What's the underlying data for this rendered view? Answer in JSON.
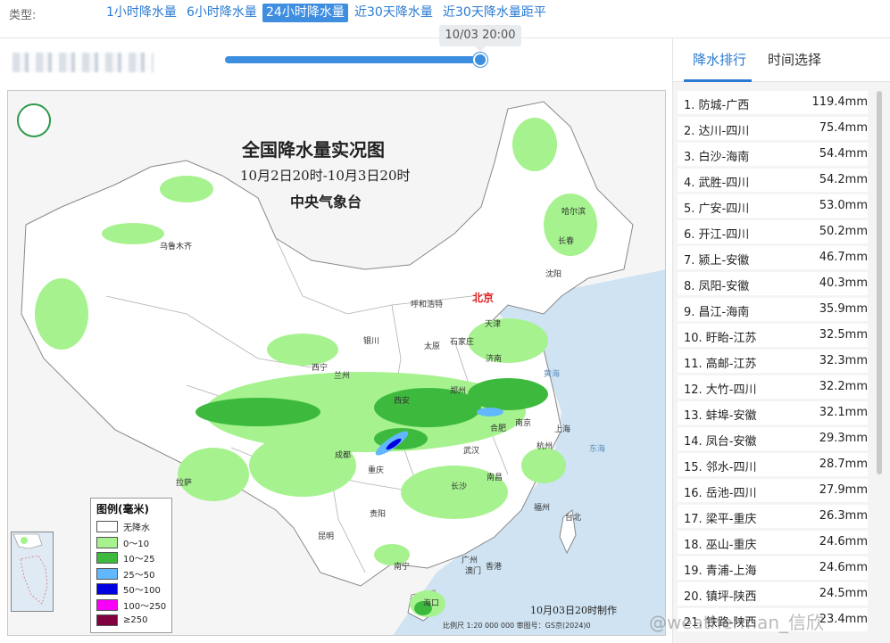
{
  "type_bar": {
    "label": "类型:",
    "tabs": [
      "1小时降水量",
      "6小时降水量",
      "24小时降水量",
      "近30天降水量",
      "近30天降水量距平"
    ],
    "active_index": 2
  },
  "slider": {
    "tooltip": "10/03 20:00",
    "position": 1.0
  },
  "map": {
    "title": "全国降水量实况图",
    "subtitle": "10月2日20时-10月3日20时",
    "agency": "中央气象台",
    "cities": [
      "乌鲁木齐",
      "哈尔滨",
      "长春",
      "沈阳",
      "北京",
      "天津",
      "呼和浩特",
      "银川",
      "太原",
      "石家庄",
      "济南",
      "西宁",
      "兰州",
      "郑州",
      "西安",
      "合肥",
      "南京",
      "上海",
      "杭州",
      "武汉",
      "成都",
      "重庆",
      "拉萨",
      "长沙",
      "南昌",
      "贵阳",
      "福州",
      "台北",
      "昆明",
      "南宁",
      "广州",
      "澳门",
      "香港",
      "海口"
    ],
    "seas": [
      "黄海",
      "东海"
    ],
    "legend": {
      "title": "图例(毫米)",
      "items": [
        {
          "label": "无降水",
          "color": "#ffffff"
        },
        {
          "label": "0～10",
          "color": "#a6f28f"
        },
        {
          "label": "10～25",
          "color": "#3dba3d"
        },
        {
          "label": "25～50",
          "color": "#61b8ff"
        },
        {
          "label": "50～100",
          "color": "#0000e1"
        },
        {
          "label": "100～250",
          "color": "#fa00fa"
        },
        {
          "label": "≥250",
          "color": "#800040"
        }
      ]
    },
    "made_note": "10月03日20时制作",
    "scale_note": "比例尺 1:20 000 000    审图号：GS京(2024)0"
  },
  "right_panel": {
    "tabs": [
      "降水排行",
      "时间选择"
    ],
    "active_index": 0,
    "ranking": [
      {
        "name": "1. 防城-广西",
        "value": "119.4mm"
      },
      {
        "name": "2. 达川-四川",
        "value": "75.4mm"
      },
      {
        "name": "3. 白沙-海南",
        "value": "54.4mm"
      },
      {
        "name": "4. 武胜-四川",
        "value": "54.2mm"
      },
      {
        "name": "5. 广安-四川",
        "value": "53.0mm"
      },
      {
        "name": "6. 开江-四川",
        "value": "50.2mm"
      },
      {
        "name": "7. 颍上-安徽",
        "value": "46.7mm"
      },
      {
        "name": "8. 凤阳-安徽",
        "value": "40.3mm"
      },
      {
        "name": "9. 昌江-海南",
        "value": "35.9mm"
      },
      {
        "name": "10. 盱眙-江苏",
        "value": "32.5mm"
      },
      {
        "name": "11. 高邮-江苏",
        "value": "32.3mm"
      },
      {
        "name": "12. 大竹-四川",
        "value": "32.2mm"
      },
      {
        "name": "13. 蚌埠-安徽",
        "value": "32.1mm"
      },
      {
        "name": "14. 凤台-安徽",
        "value": "29.3mm"
      },
      {
        "name": "15. 邻水-四川",
        "value": "28.7mm"
      },
      {
        "name": "16. 岳池-四川",
        "value": "27.9mm"
      },
      {
        "name": "17. 梁平-重庆",
        "value": "26.3mm"
      },
      {
        "name": "18. 巫山-重庆",
        "value": "24.6mm"
      },
      {
        "name": "19. 青浦-上海",
        "value": "24.6mm"
      },
      {
        "name": "20. 镇坪-陕西",
        "value": "24.5mm"
      },
      {
        "name": "21. 铁路-陕西",
        "value": "23.4mm"
      }
    ]
  },
  "watermark": "@weatherman_信欣"
}
